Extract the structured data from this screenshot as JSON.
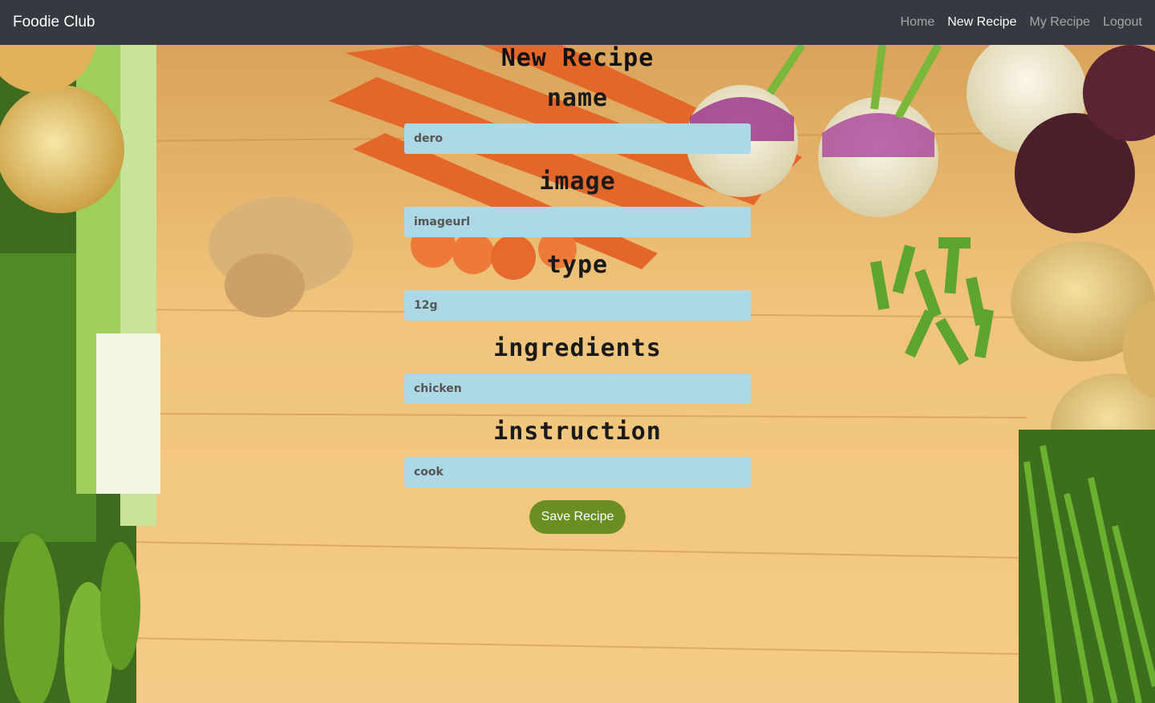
{
  "navbar": {
    "brand": "Foodie Club",
    "links": [
      {
        "label": "Home",
        "active": false
      },
      {
        "label": "New Recipe",
        "active": true
      },
      {
        "label": "My Recipe",
        "active": false
      },
      {
        "label": "Logout",
        "active": false
      }
    ]
  },
  "form": {
    "title": "New Recipe",
    "fields": [
      {
        "label": "name",
        "value": "dero"
      },
      {
        "label": "image",
        "value": "imageurl"
      },
      {
        "label": "type",
        "value": "12g"
      },
      {
        "label": "ingredients",
        "value": "chicken"
      },
      {
        "label": "instruction",
        "value": "cook"
      }
    ],
    "save_label": "Save Recipe"
  },
  "colors": {
    "navbar_bg": "#343a40",
    "input_bg": "#add8e6",
    "button_bg": "#6b8e23"
  }
}
